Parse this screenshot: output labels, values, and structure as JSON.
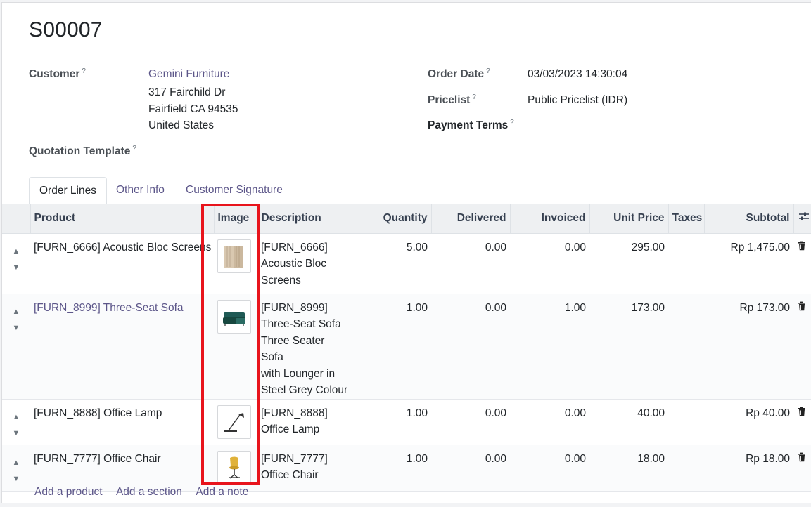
{
  "order": {
    "name": "S00007",
    "customer_label": "Customer",
    "customer_name": "Gemini Furniture",
    "address_line1": "317 Fairchild Dr",
    "address_line2": "Fairfield CA 94535",
    "address_line3": "United States",
    "quotation_template_label": "Quotation Template",
    "order_date_label": "Order Date",
    "order_date": "03/03/2023 14:30:04",
    "pricelist_label": "Pricelist",
    "pricelist": "Public Pricelist (IDR)",
    "payment_terms_label": "Payment Terms",
    "help_mark": "?"
  },
  "tabs": [
    "Order Lines",
    "Other Info",
    "Customer Signature"
  ],
  "table": {
    "headers": {
      "product": "Product",
      "image": "Image",
      "description": "Description",
      "quantity": "Quantity",
      "delivered": "Delivered",
      "invoiced": "Invoiced",
      "unit_price": "Unit Price",
      "taxes": "Taxes",
      "subtotal": "Subtotal"
    },
    "rows": [
      {
        "product": "[FURN_6666] Acoustic Bloc Screens",
        "image_icon": "acoustic-screen-image",
        "desc1": "[FURN_6666]",
        "desc2": "Acoustic Bloc",
        "desc3": "Screens",
        "quantity": "5.00",
        "delivered": "0.00",
        "invoiced": "0.00",
        "unit_price": "295.00",
        "subtotal": "Rp 1,475.00"
      },
      {
        "product": "[FURN_8999] Three-Seat Sofa",
        "image_icon": "sofa-image",
        "desc1": "[FURN_8999]",
        "desc2": "Three-Seat Sofa",
        "desc3": "Three Seater Sofa",
        "desc4": "with Lounger in",
        "desc5": "Steel Grey Colour",
        "quantity": "1.00",
        "delivered": "0.00",
        "invoiced": "1.00",
        "unit_price": "173.00",
        "subtotal": "Rp 173.00"
      },
      {
        "product": "[FURN_8888] Office Lamp",
        "image_icon": "lamp-image",
        "desc1": "[FURN_8888]",
        "desc2": "Office Lamp",
        "quantity": "1.00",
        "delivered": "0.00",
        "invoiced": "0.00",
        "unit_price": "40.00",
        "subtotal": "Rp 40.00"
      },
      {
        "product": "[FURN_7777] Office Chair",
        "image_icon": "chair-image",
        "desc1": "[FURN_7777]",
        "desc2": "Office Chair",
        "quantity": "1.00",
        "delivered": "0.00",
        "invoiced": "0.00",
        "unit_price": "18.00",
        "subtotal": "Rp 18.00"
      }
    ]
  },
  "footer": {
    "add_product": "Add a product",
    "add_section": "Add a section",
    "add_note": "Add a note"
  },
  "colors": {
    "link": "#5c5689",
    "highlight": "#e8141c",
    "header_bg": "#eef0f2"
  }
}
